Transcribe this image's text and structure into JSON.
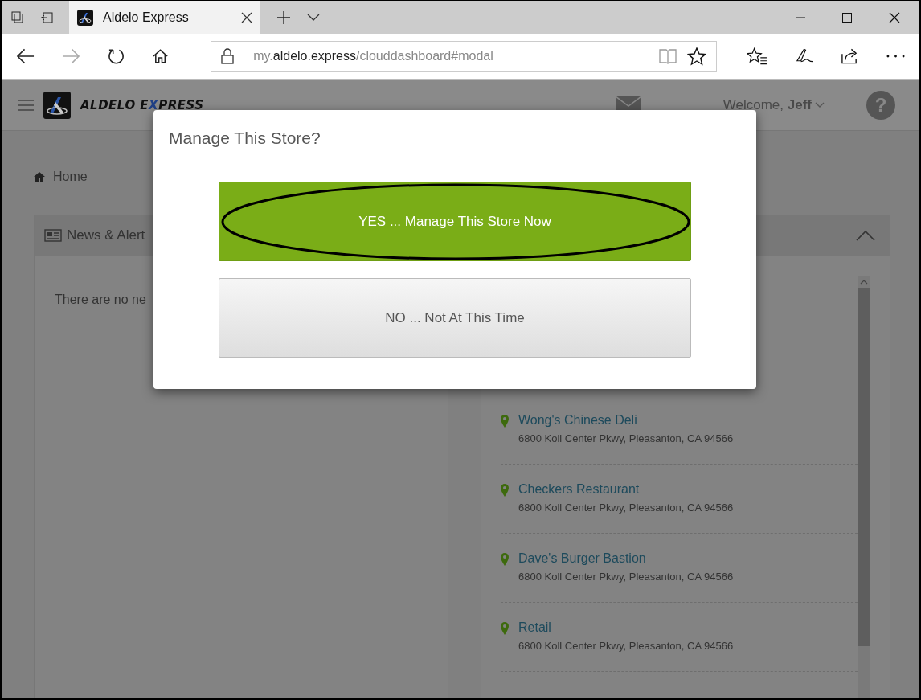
{
  "browser": {
    "tab_title": "Aldelo Express",
    "url": [
      {
        "text": "my.",
        "strong": false
      },
      {
        "text": "aldelo.express",
        "strong": true
      },
      {
        "text": "/clouddashboard#modal",
        "strong": false
      }
    ]
  },
  "header": {
    "brand": [
      {
        "text": "ALDELO E",
        "accent": false
      },
      {
        "text": "X",
        "accent": true
      },
      {
        "text": "PRESS",
        "accent": false
      }
    ],
    "welcome": "Welcome, **Jeff**",
    "help": "?"
  },
  "breadcrumb": "Home",
  "news_panel": {
    "title": "News & Alert",
    "message": "There are no ne"
  },
  "stores_panel": {
    "stores": [
      {
        "name": "Wong's Chinese Deli",
        "address": "6800 Koll Center Pkwy, Pleasanton, CA 94566"
      },
      {
        "name": "Checkers Restaurant",
        "address": "6800 Koll Center Pkwy, Pleasanton, CA 94566"
      },
      {
        "name": "Dave's Burger Bastion",
        "address": "6800 Koll Center Pkwy, Pleasanton, CA 94566"
      },
      {
        "name": "Retail",
        "address": "6800 Koll Center Pkwy, Pleasanton, CA 94566"
      }
    ]
  },
  "modal": {
    "title": "Manage This Store?",
    "buttons": [
      {
        "label": "YES ... Manage This Store Now",
        "kind": "primary",
        "circled": true
      },
      {
        "label": "NO ... Not At This Time",
        "kind": "default",
        "circled": false
      }
    ]
  }
}
